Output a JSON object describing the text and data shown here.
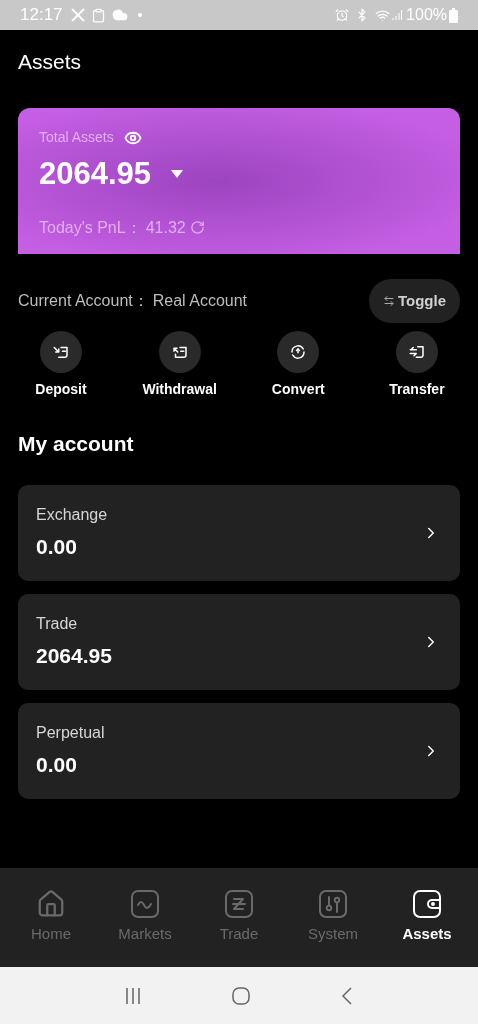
{
  "status_bar": {
    "time": "12:17",
    "battery": "100%"
  },
  "header": {
    "title": "Assets"
  },
  "total_card": {
    "label": "Total Assets",
    "value": "2064.95",
    "pnl_label": "Today's PnL：",
    "pnl_value": "41.32"
  },
  "current_account": {
    "label": "Current Account：",
    "value": "Real Account",
    "toggle": "Toggle"
  },
  "actions": [
    {
      "label": "Deposit"
    },
    {
      "label": "Withdrawal"
    },
    {
      "label": "Convert"
    },
    {
      "label": "Transfer"
    }
  ],
  "my_account": {
    "title": "My account",
    "accounts": [
      {
        "name": "Exchange",
        "balance": "0.00"
      },
      {
        "name": "Trade",
        "balance": "2064.95"
      },
      {
        "name": "Perpetual",
        "balance": "0.00"
      }
    ]
  },
  "bottom_nav": [
    {
      "label": "Home",
      "selected": false
    },
    {
      "label": "Markets",
      "selected": false
    },
    {
      "label": "Trade",
      "selected": false
    },
    {
      "label": "System",
      "selected": false
    },
    {
      "label": "Assets",
      "selected": true
    }
  ]
}
